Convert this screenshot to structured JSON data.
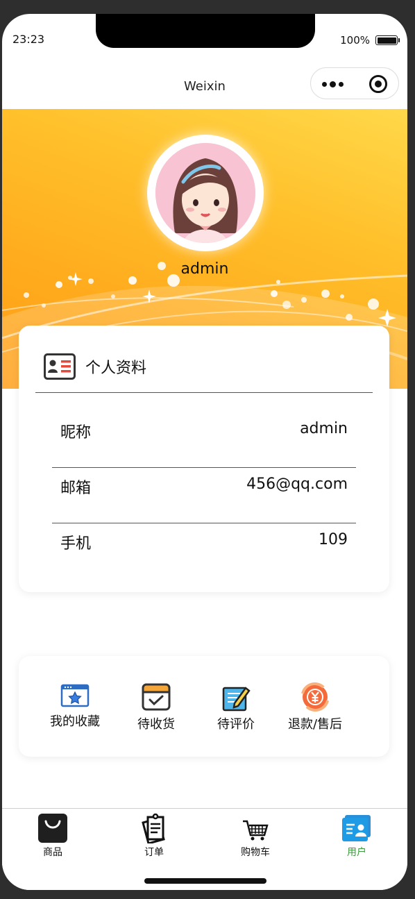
{
  "status": {
    "time": "23:23",
    "battery": "100%"
  },
  "nav": {
    "title": "Weixin",
    "more_icon": "more-dots-icon",
    "close_icon": "target-icon"
  },
  "header": {
    "username": "admin"
  },
  "profile": {
    "title": "个人资料",
    "rows": [
      {
        "label": "昵称",
        "value": "admin"
      },
      {
        "label": "邮箱",
        "value": "456@qq.com"
      },
      {
        "label": "手机",
        "value": "109"
      }
    ]
  },
  "orders": [
    {
      "label": "我的收藏",
      "icon": "favorite-icon"
    },
    {
      "label": "待收货",
      "icon": "receive-box-icon"
    },
    {
      "label": "待评价",
      "icon": "review-pencil-icon"
    },
    {
      "label": "退款/售后",
      "icon": "refund-icon"
    }
  ],
  "tabs": [
    {
      "label": "商品",
      "icon": "shopping-bag-icon"
    },
    {
      "label": "订单",
      "icon": "order-clipboard-icon"
    },
    {
      "label": "购物车",
      "icon": "cart-icon"
    },
    {
      "label": "用户",
      "icon": "user-card-icon",
      "active": true
    }
  ],
  "colors": {
    "banner": "#ffb321",
    "active_tab": "#3a9a3a"
  }
}
